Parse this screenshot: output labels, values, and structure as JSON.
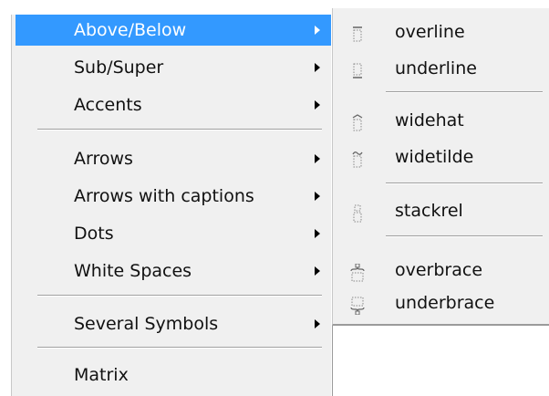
{
  "menu": {
    "items": [
      {
        "label": "Above/Below",
        "has_submenu": true,
        "selected": true
      },
      {
        "label": "Sub/Super",
        "has_submenu": true
      },
      {
        "label": "Accents",
        "has_submenu": true
      },
      {
        "label": "Arrows",
        "has_submenu": true
      },
      {
        "label": "Arrows with captions",
        "has_submenu": true
      },
      {
        "label": "Dots",
        "has_submenu": true
      },
      {
        "label": "White Spaces",
        "has_submenu": true
      },
      {
        "label": "Several Symbols",
        "has_submenu": true
      },
      {
        "label": "Matrix",
        "has_submenu": false
      }
    ]
  },
  "submenu": {
    "items": [
      {
        "label": "overline",
        "icon": "overline-icon"
      },
      {
        "label": "underline",
        "icon": "underline-icon"
      },
      {
        "label": "widehat",
        "icon": "widehat-icon"
      },
      {
        "label": "widetilde",
        "icon": "widetilde-icon"
      },
      {
        "label": "stackrel",
        "icon": "stackrel-icon"
      },
      {
        "label": "overbrace",
        "icon": "overbrace-icon"
      },
      {
        "label": "underbrace",
        "icon": "underbrace-icon"
      }
    ]
  },
  "colors": {
    "menu_background": "#f0f0f0",
    "selection": "#3399ff",
    "separator": "#a0a0a0"
  }
}
